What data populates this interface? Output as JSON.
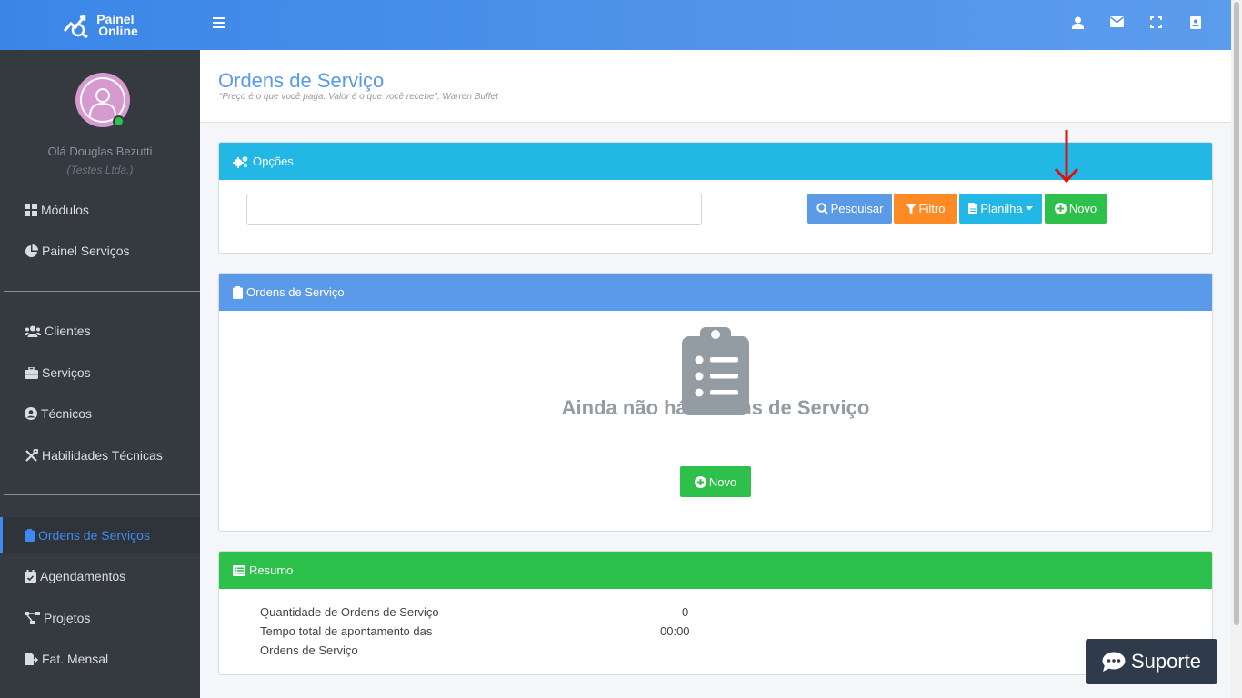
{
  "app": {
    "logo_line1": "Painel",
    "logo_line2": "Online"
  },
  "user": {
    "greeting": "Olá Douglas Bezutti",
    "company": "(Testes Ltda.)"
  },
  "sidebar": {
    "items": [
      {
        "label": "Módulos",
        "icon": "grid-icon"
      },
      {
        "label": "Painel Serviços",
        "icon": "pie-chart-icon"
      },
      {
        "label": "Clientes",
        "icon": "users-icon"
      },
      {
        "label": "Serviços",
        "icon": "briefcase-icon"
      },
      {
        "label": "Técnicos",
        "icon": "user-circle-icon"
      },
      {
        "label": "Habilidades Técnicas",
        "icon": "tools-icon"
      },
      {
        "label": "Ordens de Serviços",
        "icon": "clipboard-icon",
        "active": true
      },
      {
        "label": "Agendamentos",
        "icon": "calendar-check-icon"
      },
      {
        "label": "Projetos",
        "icon": "project-diagram-icon"
      },
      {
        "label": "Fat. Mensal",
        "icon": "file-export-icon"
      }
    ]
  },
  "page": {
    "title": "Ordens de Serviço",
    "quote": "“Preço é o que você paga. Valor é o que você recebe”, Warren Buffet"
  },
  "options_card": {
    "title": "Opções",
    "search_value": "",
    "search_placeholder": "",
    "buttons": {
      "search": "Pesquisar",
      "filter": "Filtro",
      "spreadsheet": "Planilha",
      "new": "Novo"
    }
  },
  "orders_card": {
    "title": "Ordens de Serviço",
    "empty_message": "Ainda não há Ordens de Serviço",
    "new_button": "Novo"
  },
  "summary_card": {
    "title": "Resumo",
    "rows": [
      {
        "label": "Quantidade de Ordens de Serviço",
        "value": "0"
      },
      {
        "label_line1": "Tempo total de apontamento das",
        "label_line2": "Ordens de Serviço",
        "value": "00:00"
      }
    ]
  },
  "support": {
    "label": "Suporte"
  },
  "colors": {
    "header": "#4f93e9",
    "sidebar": "#343a40",
    "options_header": "#23b7e5",
    "orders_header": "#5a9ae8",
    "summary_header": "#2dc14b",
    "btn_search": "#5b9ae6",
    "btn_filter": "#fd8a25",
    "btn_spreadsheet": "#23b7e5",
    "btn_new": "#2dc14b",
    "annotation_arrow": "#e01010"
  }
}
